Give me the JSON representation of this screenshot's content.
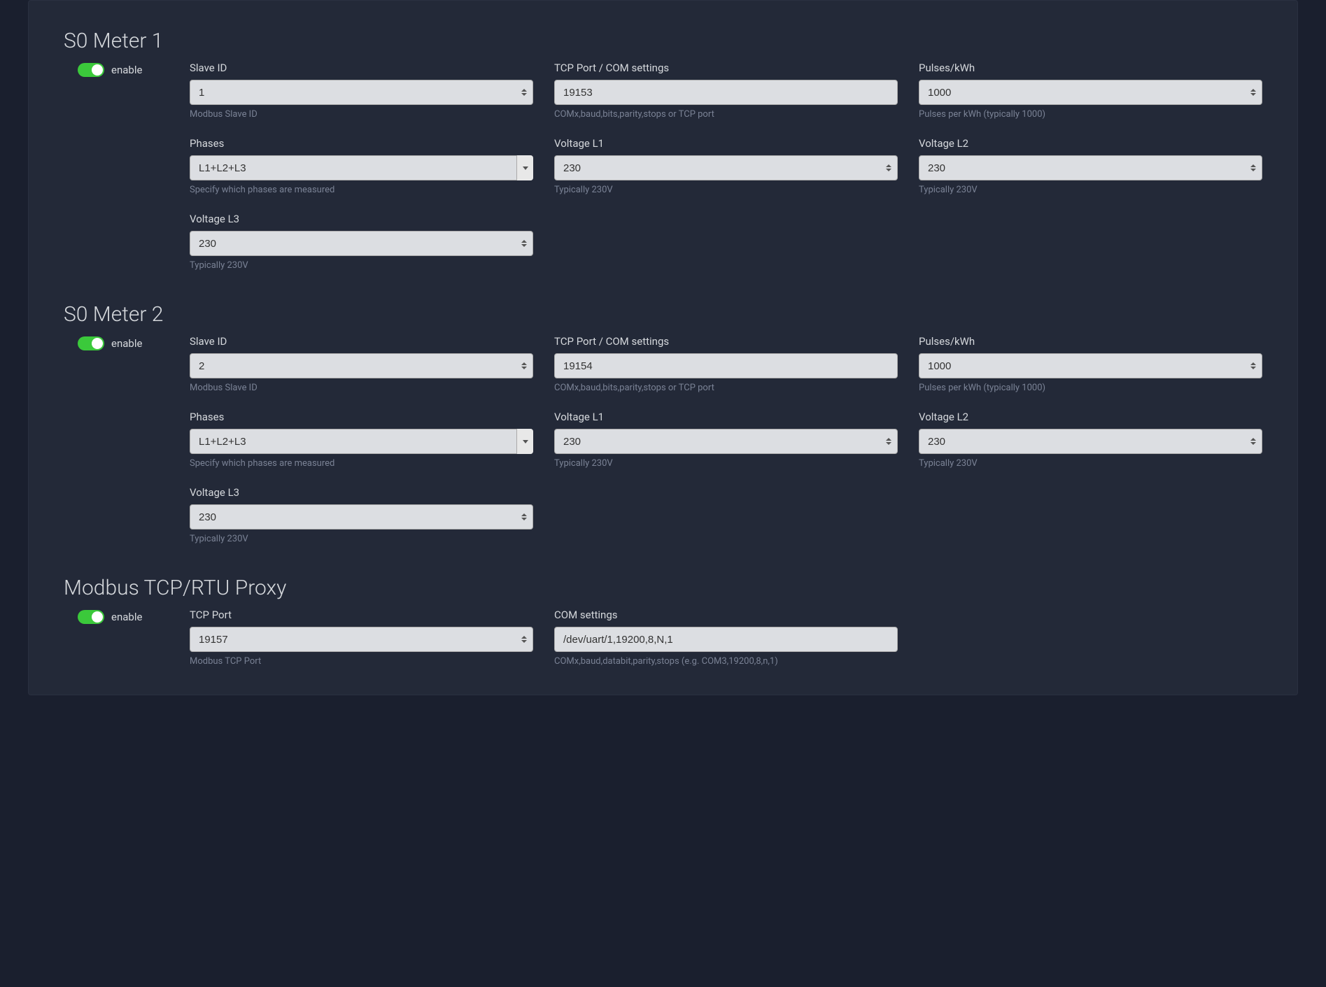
{
  "meter1": {
    "title": "S0 Meter 1",
    "enable_label": "enable",
    "slave_id": {
      "label": "Slave ID",
      "value": "1",
      "hint": "Modbus Slave ID"
    },
    "tcp_port": {
      "label": "TCP Port / COM settings",
      "value": "19153",
      "hint": "COMx,baud,bits,parity,stops or TCP port"
    },
    "pulses": {
      "label": "Pulses/kWh",
      "value": "1000",
      "hint": "Pulses per kWh (typically 1000)"
    },
    "phases": {
      "label": "Phases",
      "value": "L1+L2+L3",
      "hint": "Specify which phases are measured"
    },
    "v_l1": {
      "label": "Voltage L1",
      "value": "230",
      "hint": "Typically 230V"
    },
    "v_l2": {
      "label": "Voltage L2",
      "value": "230",
      "hint": "Typically 230V"
    },
    "v_l3": {
      "label": "Voltage L3",
      "value": "230",
      "hint": "Typically 230V"
    }
  },
  "meter2": {
    "title": "S0 Meter 2",
    "enable_label": "enable",
    "slave_id": {
      "label": "Slave ID",
      "value": "2",
      "hint": "Modbus Slave ID"
    },
    "tcp_port": {
      "label": "TCP Port / COM settings",
      "value": "19154",
      "hint": "COMx,baud,bits,parity,stops or TCP port"
    },
    "pulses": {
      "label": "Pulses/kWh",
      "value": "1000",
      "hint": "Pulses per kWh (typically 1000)"
    },
    "phases": {
      "label": "Phases",
      "value": "L1+L2+L3",
      "hint": "Specify which phases are measured"
    },
    "v_l1": {
      "label": "Voltage L1",
      "value": "230",
      "hint": "Typically 230V"
    },
    "v_l2": {
      "label": "Voltage L2",
      "value": "230",
      "hint": "Typically 230V"
    },
    "v_l3": {
      "label": "Voltage L3",
      "value": "230",
      "hint": "Typically 230V"
    }
  },
  "proxy": {
    "title": "Modbus TCP/RTU Proxy",
    "enable_label": "enable",
    "tcp_port": {
      "label": "TCP Port",
      "value": "19157",
      "hint": "Modbus TCP Port"
    },
    "com": {
      "label": "COM settings",
      "value": "/dev/uart/1,19200,8,N,1",
      "hint": "COMx,baud,databit,parity,stops (e.g. COM3,19200,8,n,1)"
    }
  }
}
